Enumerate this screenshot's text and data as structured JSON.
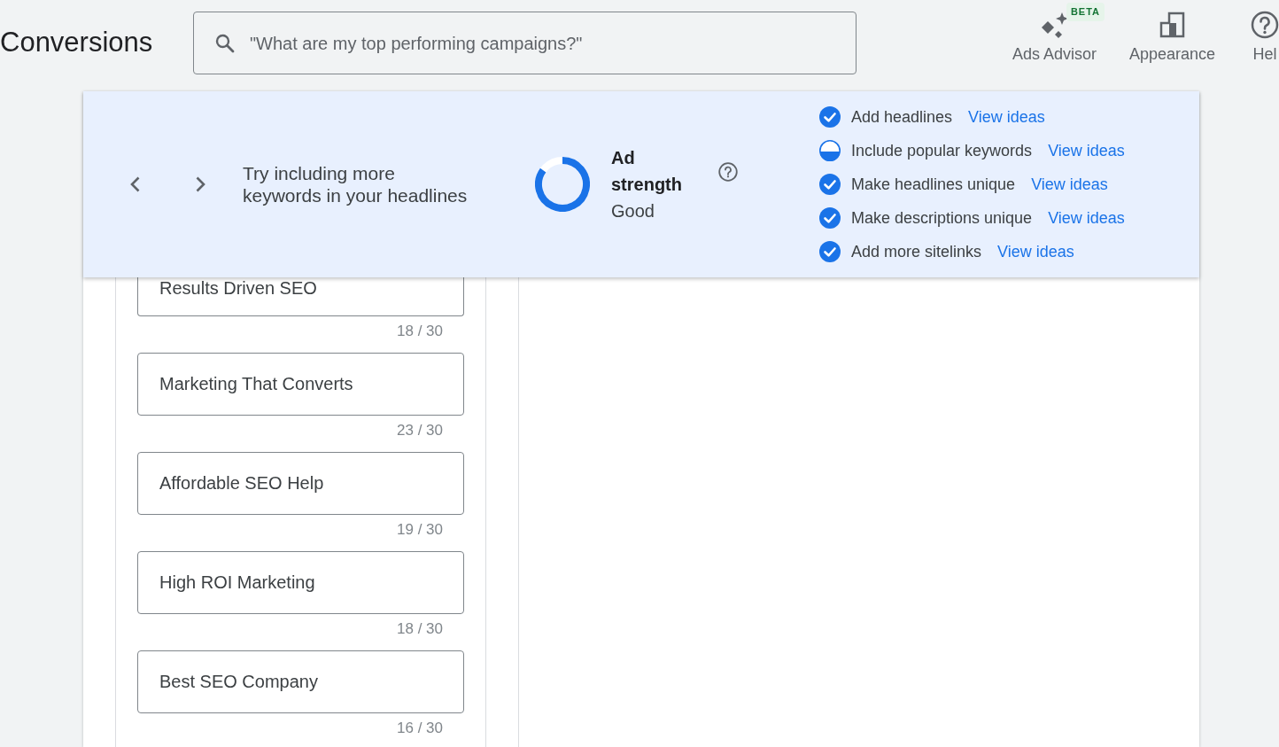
{
  "header": {
    "title": "Conversions",
    "search": {
      "placeholder": "\"What are my top performing campaigns?\""
    },
    "actions": [
      {
        "kind": "sparkle",
        "label": "Ads Advisor",
        "badge": "BETA"
      },
      {
        "kind": "appearance",
        "label": "Appearance"
      },
      {
        "kind": "help",
        "label": "Hel"
      }
    ]
  },
  "suggestion_panel": {
    "tip": "Try including more keywords in your headlines",
    "ad_strength": {
      "label": "Ad strength",
      "rating": "Good",
      "level": 0.85
    },
    "checklist": [
      {
        "kind": "complete",
        "label": "Add headlines",
        "link": "View ideas"
      },
      {
        "kind": "partial",
        "label": "Include popular keywords",
        "link": "View ideas"
      },
      {
        "kind": "complete",
        "label": "Make headlines unique",
        "link": "View ideas"
      },
      {
        "kind": "complete",
        "label": "Make descriptions unique",
        "link": "View ideas"
      },
      {
        "kind": "complete",
        "label": "Add more sitelinks",
        "link": "View ideas"
      }
    ]
  },
  "headlines": [
    {
      "value": "Results Driven SEO",
      "counter": "18 / 30"
    },
    {
      "value": "Marketing That Converts",
      "counter": "23 / 30"
    },
    {
      "value": "Affordable SEO Help",
      "counter": "19 / 30"
    },
    {
      "value": "High ROI Marketing",
      "counter": "18 / 30"
    },
    {
      "value": "Best SEO Company",
      "counter": "16 / 30"
    }
  ]
}
